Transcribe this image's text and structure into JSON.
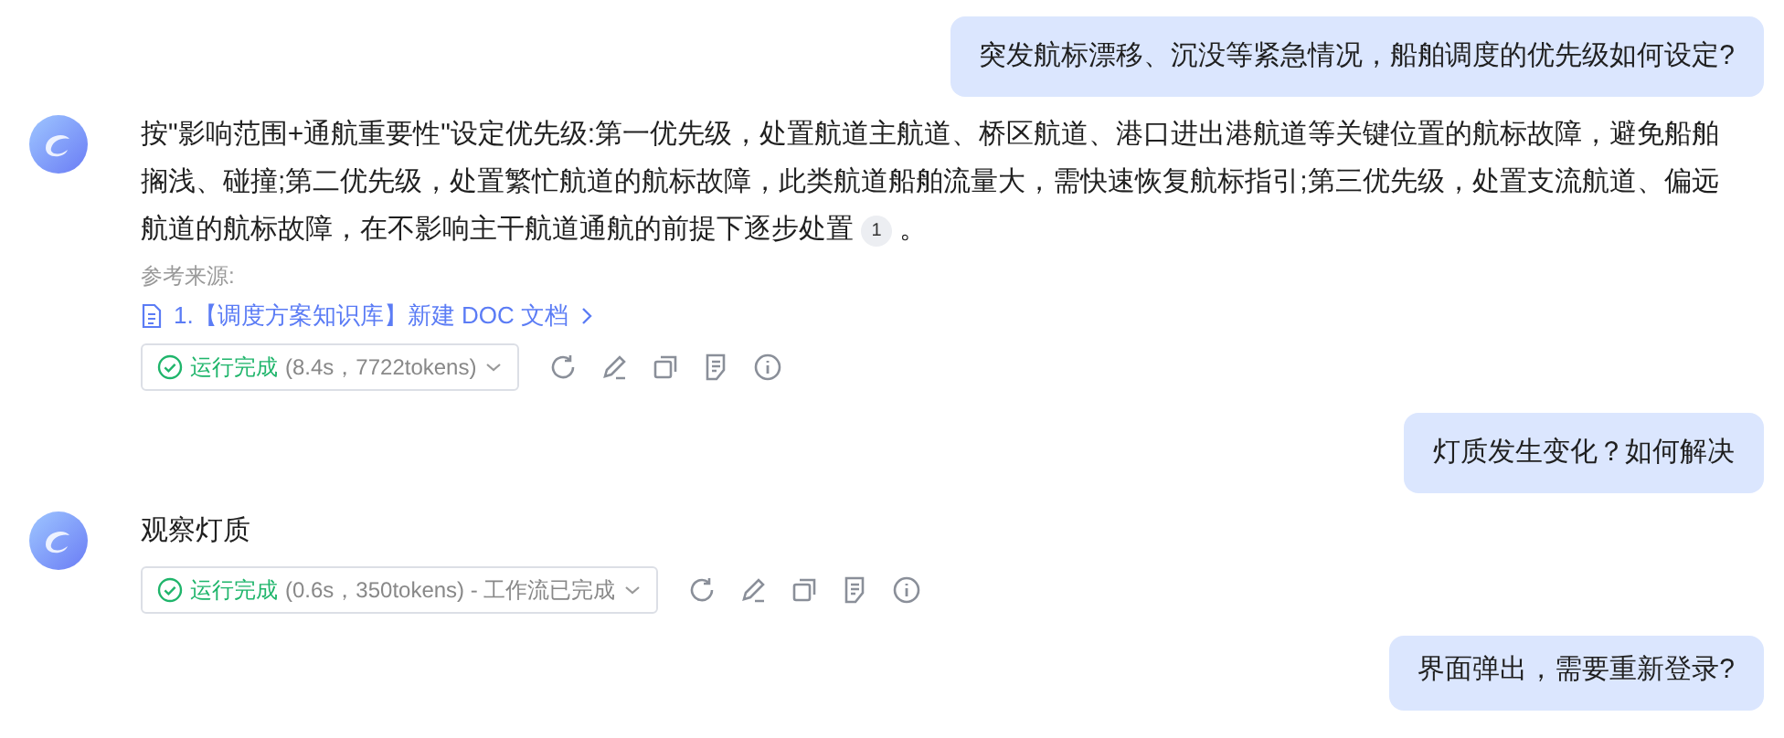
{
  "messages": [
    {
      "kind": "user",
      "text": "突发航标漂移、沉没等紧急情况，船舶调度的优先级如何设定?"
    },
    {
      "kind": "bot",
      "text": "按\"影响范围+通航重要性\"设定优先级:第一优先级，处置航道主航道、桥区航道、港口进出港航道等关键位置的航标故障，避免船舶搁浅、碰撞;第二优先级，处置繁忙航道的航标故障，此类航道船舶流量大，需快速恢复航标指引;第三优先级，处置支流航道、偏远航道的航标故障，在不影响主干航道通航的前提下逐步处置",
      "citation": "1",
      "tail": "。",
      "sources_label": "参考来源:",
      "sources": [
        "1.【调度方案知识库】新建 DOC 文档"
      ],
      "status": "运行完成",
      "detail": "(8.4s，7722tokens)"
    },
    {
      "kind": "user",
      "text": "灯质发生变化？如何解决"
    },
    {
      "kind": "bot",
      "text": "观察灯质",
      "status": "运行完成",
      "detail": "(0.6s，350tokens) - 工作流已完成"
    },
    {
      "kind": "user",
      "text": "界面弹出，需要重新登录?"
    }
  ]
}
